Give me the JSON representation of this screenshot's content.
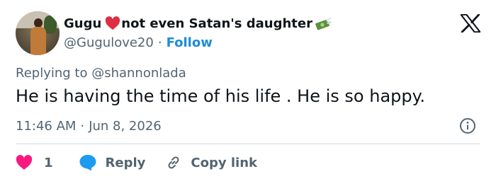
{
  "author": {
    "display_name": "Gugu",
    "display_name_suffix": "not even Satan's daughter",
    "handle": "@Gugulove20",
    "separator": "·",
    "follow_label": "Follow"
  },
  "tweet": {
    "replying_to": "Replying to @shannonlada",
    "text": "He is having the time of his life . He is so happy.",
    "time": "11:46 AM",
    "separator": "·",
    "date": "Jun 8, 2026"
  },
  "actions": {
    "like_count": "1",
    "reply_label": "Reply",
    "copy_label": "Copy link"
  },
  "icons": {
    "logo": "x-logo-icon",
    "info": "info-icon",
    "like": "heart-icon",
    "reply": "speech-bubble-icon",
    "copy": "link-icon",
    "name_emoji_1": "red-heart-icon",
    "name_emoji_2": "money-with-wings-icon"
  },
  "colors": {
    "text": "#0f1419",
    "secondary": "#536471",
    "link": "#1d8cd8",
    "like": "#f91880",
    "reply": "#1d9bf0",
    "divider": "#cfd9de"
  }
}
